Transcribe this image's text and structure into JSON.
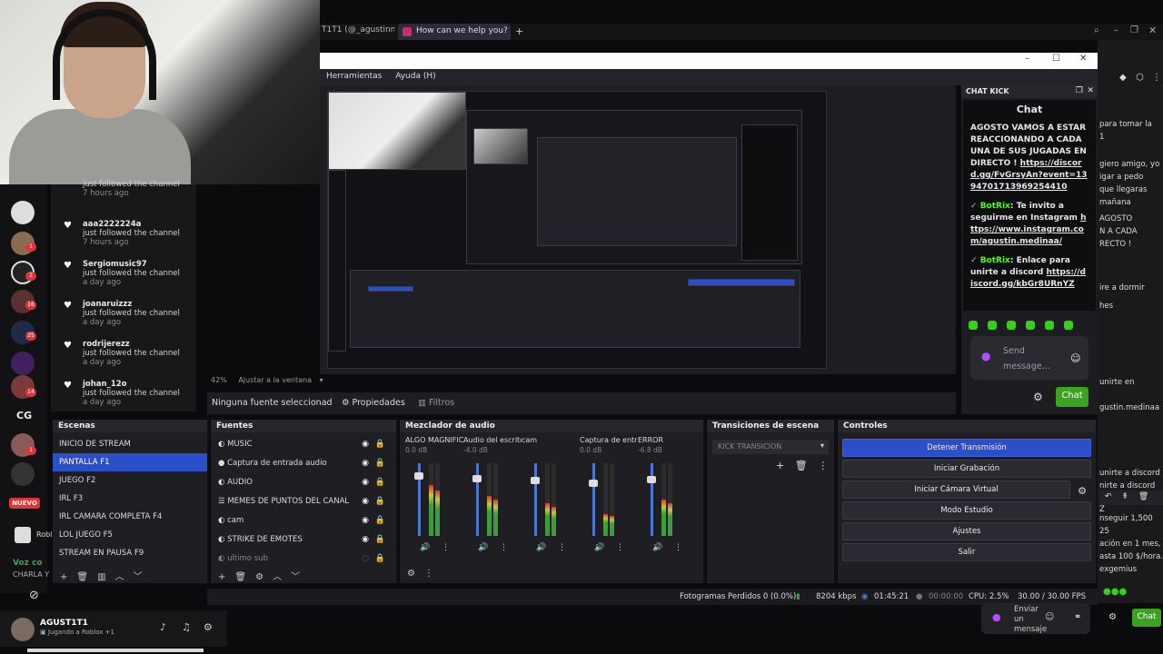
{
  "browser": {
    "tab1": "T1T1 (@_agustinme",
    "tab2": "How can we help you? - C"
  },
  "obs": {
    "menu": [
      "Herramientas",
      "Ayuda (H)"
    ],
    "zoom": "42%",
    "zoom_fit": "Ajustar a la ventana",
    "no_source": "Ninguna fuente seleccionad",
    "properties_btn": "Propiedades",
    "filters_btn": "Filtros",
    "scenes_title": "Escenas",
    "scenes": [
      "INICIO DE STREAM",
      "PANTALLA F1",
      "JUEGO F2",
      "IRL F3",
      "IRL CAMARA COMPLETA F4",
      "LOL JUEGO F5",
      "STREAM EN PAUSA F9"
    ],
    "sources_title": "Fuentes",
    "sources": [
      "MUSIC",
      "Captura de entrada audio",
      "AUDIO",
      "MEMES DE PUNTOS DEL CANAL",
      "cam",
      "STRIKE DE EMOTES",
      "ultimo sub"
    ],
    "mixer_title": "Mezclador de audio",
    "mixer": [
      {
        "name": "ALGO MAGNIFIC",
        "db": "0.0 dB",
        "level": 0.7
      },
      {
        "name": "Audio del escrito",
        "db": "-4.0 dB",
        "level": 0.55
      },
      {
        "name": "cam",
        "db": "",
        "level": 0.45
      },
      {
        "name": "Captura de entra",
        "db": "0.0 dB",
        "level": 0.3
      },
      {
        "name": "ERROR",
        "db": "-6.8 dB",
        "level": 0.5
      }
    ],
    "transitions_title": "Transiciones de escena",
    "transition_value": "KICK TRANSICION",
    "controls_title": "Controles",
    "controls": [
      "Detener Transmisión",
      "Iniciar Grabación",
      "Iniciar Cámara Virtual",
      "Modo Estudio",
      "Ajustes",
      "Salir"
    ],
    "status": {
      "dropped": "Fotogramas Perdidos 0 (0.0%)",
      "kbps": "8204 kbps",
      "live_time": "01:45:21",
      "rec_time": "00:00:00",
      "cpu": "CPU: 2.5%",
      "fps": "30.00 / 30.00 FPS"
    }
  },
  "kick": {
    "dock_title": "CHAT KICK",
    "chat_title": "Chat",
    "msg1": "AGOSTO VAMOS A ESTAR REACCIONANDO A CADA UNA DE SUS JUGADAS EN DIRECTO ! ",
    "msg1_link": "https://discord.gg/FvGrsyAn?event=1394701713969254410",
    "bot_name": "BotRix",
    "msg2": ": Te invito a seguirme en Instagram ",
    "msg2_link": "https://www.instagram.com/agustin.medinaa/",
    "msg3": ": Enlace para unirte a discord ",
    "msg3_link": "https://discord.gg/kbGr8URnYZ",
    "send_placeholder": "Send message...",
    "chat_button": "Chat"
  },
  "followers": [
    {
      "name": "",
      "action": "just followed the channel",
      "time": "7 hours ago"
    },
    {
      "name": "aaa2222224a",
      "action": "just followed the channel",
      "time": "7 hours ago"
    },
    {
      "name": "Sergiomusic97",
      "action": "just followed the channel",
      "time": "a day ago"
    },
    {
      "name": "joanaruizzz",
      "action": "just followed the channel",
      "time": "a day ago"
    },
    {
      "name": "rodrijerezz",
      "action": "just followed the channel",
      "time": "a day ago"
    },
    {
      "name": "johan_12o",
      "action": "just followed the channel",
      "time": "a day ago"
    }
  ],
  "discord": {
    "nuevo": "NUEVO",
    "badges": [
      "1",
      "2",
      "16",
      "25",
      "14",
      "1"
    ],
    "cg_label": "CG",
    "username": "AGUST1T1",
    "user_status": "Jugando a Roblox +1",
    "roblox_label": "Robl",
    "voice_label": "Voz co",
    "voice_sub": "CHARLA Y",
    "bottom_send": "Enviar un mensaje",
    "bottom_chat": "Chat",
    "right_lines": [
      "para tomar la",
      "1",
      "giero amigo, yo",
      "igar a pedo",
      "que llegaras",
      "mañana",
      "AGOSTO",
      "N A CADA",
      "RECTO !",
      "ire a dormir",
      "hes",
      "unirte a discord",
      "gustin.medinaa",
      "nirte a discord",
      "Z",
      "nseguir 1,500",
      "25",
      "ación en 1 mes,",
      "asta 100 $/hora.",
      "exgemius",
      "unirte en"
    ]
  },
  "colors": {
    "accent_blue": "#2b4fc9",
    "kick_green": "#53fc18",
    "chat_button_green": "#3aa320",
    "badge_red": "#e0343c"
  }
}
